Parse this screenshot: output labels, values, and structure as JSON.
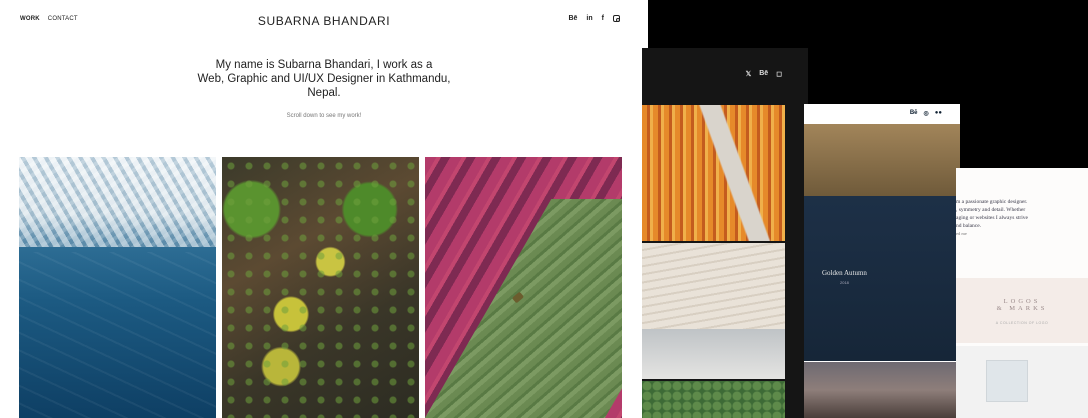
{
  "nav": {
    "items": [
      "WORK",
      "CONTACT"
    ]
  },
  "site_title": "SUBARNA BHANDARI",
  "social": {
    "behance": "Bē",
    "linkedin": "in",
    "facebook": "f",
    "instagram": "instagram-icon"
  },
  "intro": {
    "line1": "My name is Subarna Bhandari, I work as a",
    "line2": "Web, Graphic and UI/UX Designer in Kathmandu,",
    "line3": "Nepal."
  },
  "scroll_note": "Scroll down to see my work!",
  "gallery": [
    "ice-aerial-photo",
    "forest-aerial-photo",
    "tulip-field-aerial-photo"
  ],
  "mockup_dark": {
    "social": [
      "twitter",
      "Bē",
      "instagram"
    ]
  },
  "mockup_light": {
    "social": [
      "Bē",
      "instagram",
      "flickr"
    ],
    "card_title": "Golden Autumn",
    "card_sub": "2018"
  },
  "mockup_text": {
    "line1": "m a passionate graphic designer.",
    "line2": ", symmetry and detail. Whether",
    "line3": "aging or websites I always strive",
    "line4": "nd balance.",
    "small": "ed me",
    "logos_title_1": "LOGOS",
    "logos_title_2": "& MARKS",
    "logos_sub": "A COLLECTION OF LOGO"
  }
}
